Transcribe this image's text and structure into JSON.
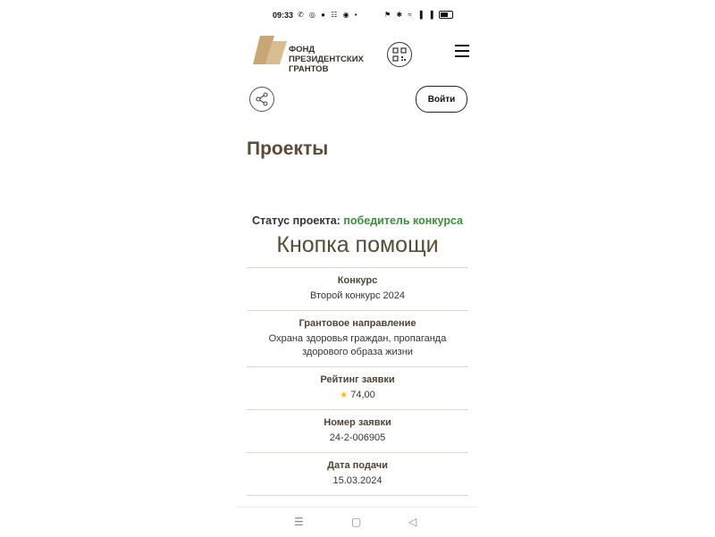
{
  "status_bar": {
    "time": "09:33",
    "left_icons": "✆ ◎ ● ☷ ◉ •",
    "right_icons": "⚑ ✱ ≈ ▐ ▐"
  },
  "header": {
    "logo_text_1": "ФОНД",
    "logo_text_2": "ПРЕЗИДЕНТСКИХ",
    "logo_text_3": "ГРАНТОВ",
    "login_label": "Войти"
  },
  "page": {
    "title": "Проекты"
  },
  "project": {
    "status_label": "Статус проекта:",
    "status_value": "победитель конкурса",
    "name": "Кнопка помощи",
    "details": [
      {
        "label": "Конкурс",
        "value": "Второй конкурс 2024"
      },
      {
        "label": "Грантовое направление",
        "value": "Охрана здоровья граждан, пропаганда здорового образа жизни"
      },
      {
        "label": "Рейтинг заявки",
        "value": "74,00"
      },
      {
        "label": "Номер заявки",
        "value": "24-2-006905"
      },
      {
        "label": "Дата подачи",
        "value": "15.03.2024"
      }
    ]
  },
  "nav": {
    "menu_icon": "☰",
    "home_icon": "▢",
    "back_icon": "◁"
  },
  "colors": {
    "brand_brown": "#5b4a35",
    "status_green": "#3c8f3a",
    "logo_tan": "#c9a676"
  }
}
